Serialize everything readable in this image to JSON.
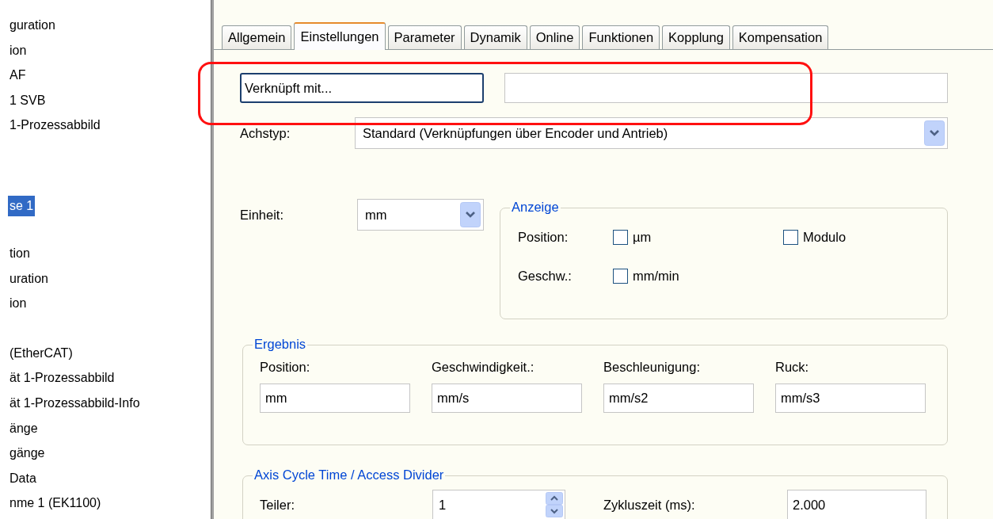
{
  "tree": {
    "groups": [
      {
        "items": [
          {
            "label": "guration",
            "selected": false
          },
          {
            "label": "ion",
            "selected": false
          },
          {
            "label": "AF",
            "selected": false
          },
          {
            "label": "1 SVB",
            "selected": false
          },
          {
            "label": "1-Prozessabbild",
            "selected": false
          }
        ]
      },
      {
        "items": [
          {
            "label": "se 1",
            "selected": true
          }
        ]
      },
      {
        "items": [
          {
            "label": "tion",
            "selected": false
          },
          {
            "label": "uration",
            "selected": false
          },
          {
            "label": "ion",
            "selected": false
          }
        ]
      },
      {
        "items": [
          {
            "label": "(EtherCAT)",
            "selected": false
          },
          {
            "label": "ät 1-Prozessabbild",
            "selected": false
          },
          {
            "label": "ät 1-Prozessabbild-Info",
            "selected": false
          },
          {
            "label": "änge",
            "selected": false
          },
          {
            "label": "gänge",
            "selected": false
          },
          {
            "label": "Data",
            "selected": false
          },
          {
            "label": "nme 1 (EK1100)",
            "selected": false
          }
        ]
      }
    ]
  },
  "tabs": [
    {
      "label": "Allgemein",
      "selected": false
    },
    {
      "label": "Einstellungen",
      "selected": true
    },
    {
      "label": "Parameter",
      "selected": false
    },
    {
      "label": "Dynamik",
      "selected": false
    },
    {
      "label": "Online",
      "selected": false
    },
    {
      "label": "Funktionen",
      "selected": false
    },
    {
      "label": "Kopplung",
      "selected": false
    },
    {
      "label": "Kompensation",
      "selected": false
    }
  ],
  "linked_button": {
    "label": "Verknüpft mit..."
  },
  "axis_type": {
    "label": "Achstyp:",
    "value": "Standard (Verknüpfungen über Encoder und Antrieb)"
  },
  "unit": {
    "label": "Einheit:",
    "value": "mm"
  },
  "display_group": {
    "legend": "Anzeige",
    "position_label": "Position:",
    "speed_label": "Geschw.:",
    "checkboxes": [
      {
        "label": "µm",
        "checked": false
      },
      {
        "label": "Modulo",
        "checked": false
      },
      {
        "label": "mm/min",
        "checked": false
      }
    ]
  },
  "result_group": {
    "legend": "Ergebnis",
    "fields": [
      {
        "label": "Position:",
        "value": "mm"
      },
      {
        "label": "Geschwindigkeit.:",
        "value": "mm/s"
      },
      {
        "label": "Beschleunigung:",
        "value": "mm/s2"
      },
      {
        "label": "Ruck:",
        "value": "mm/s3"
      }
    ]
  },
  "cycle_group": {
    "legend": "Axis Cycle Time / Access Divider",
    "divider_label": "Teiler:",
    "divider_value": "1",
    "cycle_label": "Zykluszeit (ms):",
    "cycle_value": "2.000"
  }
}
